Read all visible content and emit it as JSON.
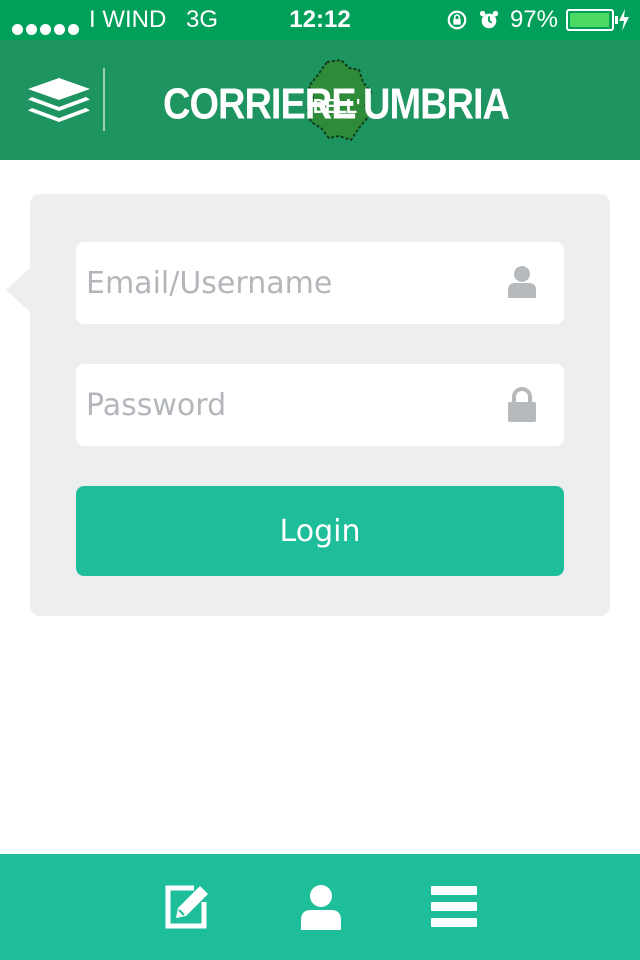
{
  "status_bar": {
    "carrier": "I WIND",
    "network": "3G",
    "time": "12:12",
    "battery_percent": "97%",
    "battery_level": 0.97,
    "icons": [
      "rotation-lock-icon",
      "alarm-icon",
      "charging-bolt-icon"
    ]
  },
  "header": {
    "menu_icon": "layers-icon",
    "logo": {
      "text_left": "CORRIERE",
      "text_mid": "DELL'",
      "text_right": "UMBRIA"
    }
  },
  "login_form": {
    "email_placeholder": "Email/Username",
    "email_value": "",
    "email_icon": "user-icon",
    "password_placeholder": "Password",
    "password_value": "",
    "password_icon": "lock-icon",
    "login_label": "Login"
  },
  "bottom_bar": {
    "tabs": [
      {
        "icon": "edit-icon"
      },
      {
        "icon": "user-icon"
      },
      {
        "icon": "menu-icon"
      }
    ]
  },
  "colors": {
    "status_bar": "#00a05a",
    "header": "#1e9560",
    "accent": "#1ebe9a",
    "card": "#edeeef",
    "placeholder": "#b3b7bb"
  }
}
